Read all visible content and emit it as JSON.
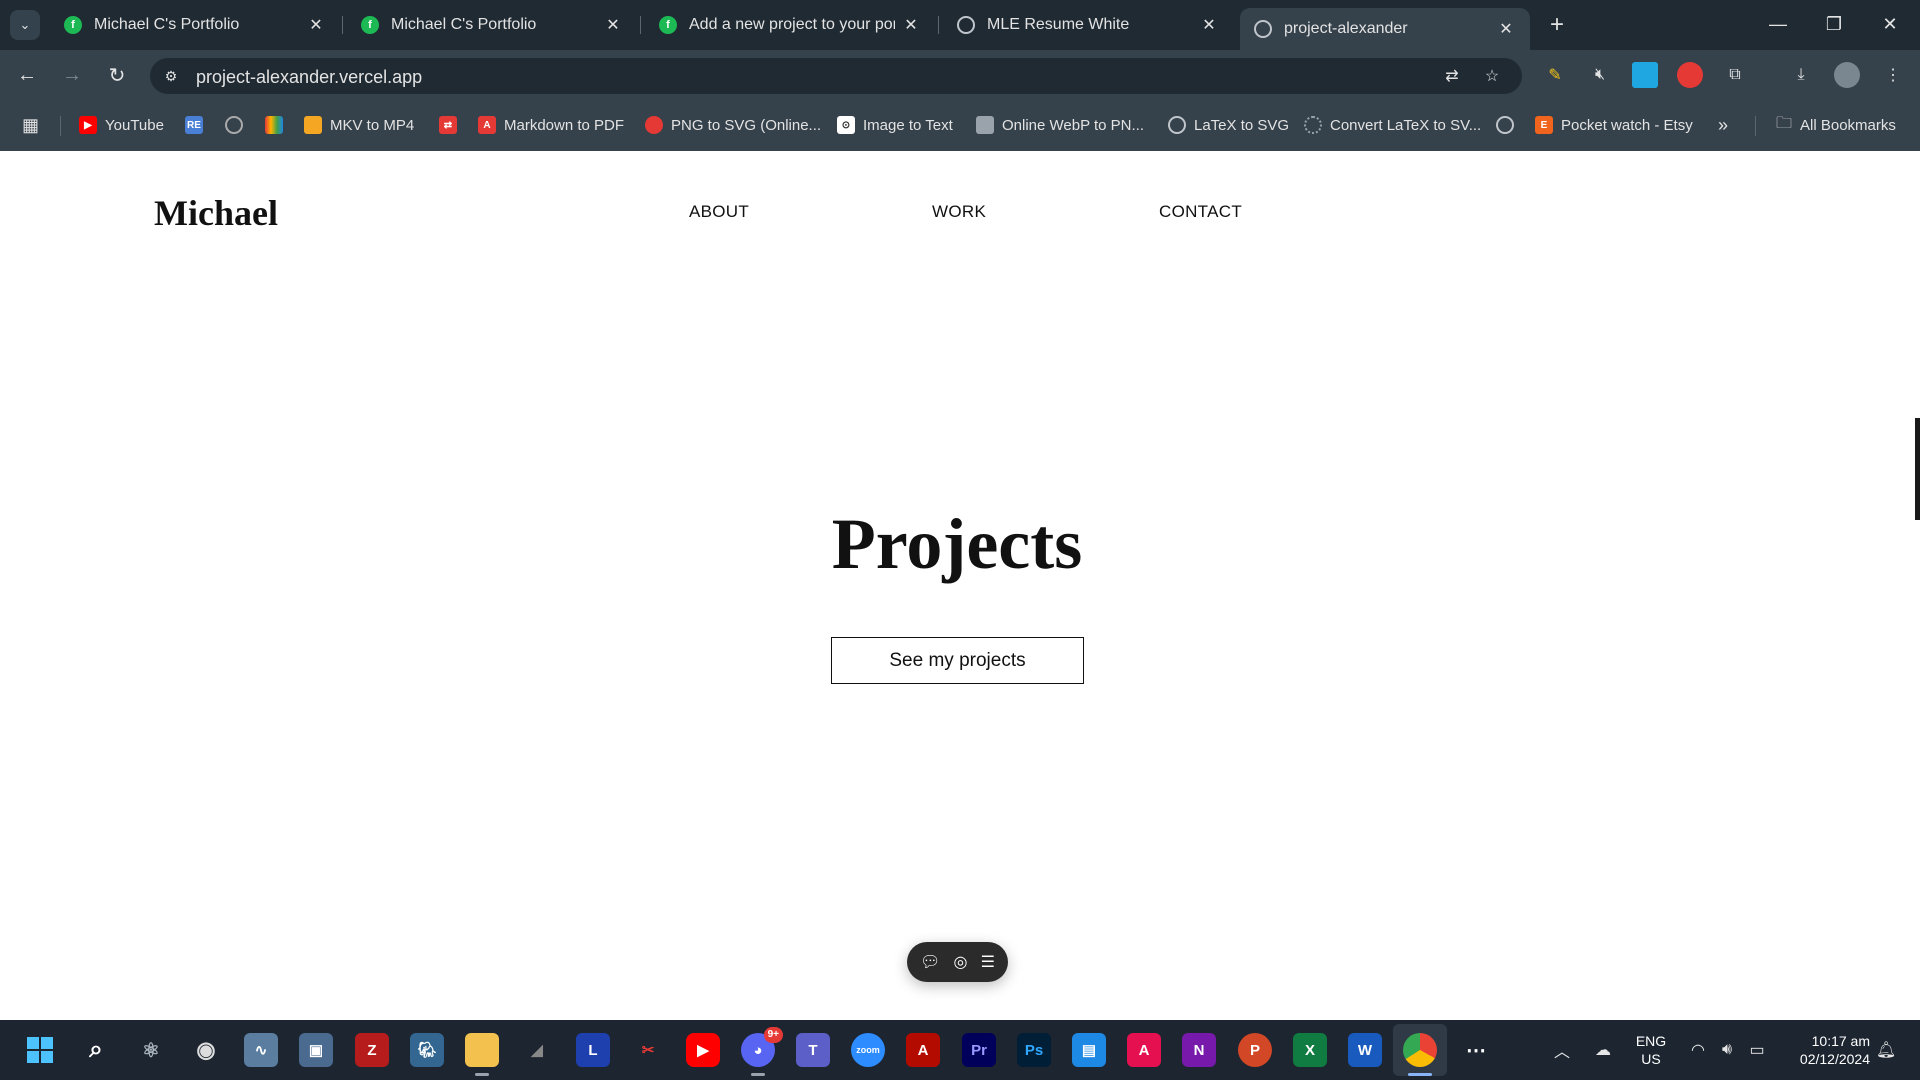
{
  "browser": {
    "tabs": [
      {
        "title": "Michael C's Portfolio",
        "favicon": "framer-green-icon",
        "active": false
      },
      {
        "title": "Michael C's Portfolio",
        "favicon": "framer-green-icon",
        "active": false
      },
      {
        "title": "Add a new project to your portf",
        "favicon": "framer-green-icon",
        "active": false
      },
      {
        "title": "MLE Resume White",
        "favicon": "globe-icon",
        "active": false
      },
      {
        "title": "project-alexander",
        "favicon": "globe-icon",
        "active": true
      }
    ],
    "url": "project-alexander.vercel.app",
    "bookmarks": [
      {
        "label": "YouTube",
        "icon": "youtube-icon",
        "color": "#ff0000"
      },
      {
        "label": "",
        "icon": "repo-icon",
        "color": "#4a7fd6"
      },
      {
        "label": "",
        "icon": "fingerprint-icon",
        "color": "#aaaaaa"
      },
      {
        "label": "",
        "icon": "color-grid-icon",
        "color": "#ffb300"
      },
      {
        "label": "MKV to MP4",
        "icon": "mkv-icon",
        "color": "#f5a623"
      },
      {
        "label": "",
        "icon": "convert-icon",
        "color": "#e53935"
      },
      {
        "label": "Markdown to PDF",
        "icon": "markdown-pdf-icon",
        "color": "#e53935"
      },
      {
        "label": "PNG to SVG (Online...",
        "icon": "png-svg-icon",
        "color": "#e53935"
      },
      {
        "label": "Image to Text",
        "icon": "image-text-icon",
        "color": "#ffffff"
      },
      {
        "label": "Online WebP to PN...",
        "icon": "webp-icon",
        "color": "#9aa3ab"
      },
      {
        "label": "LaTeX to SVG",
        "icon": "globe-icon",
        "color": "#bfc5ca"
      },
      {
        "label": "Convert LaTeX to SV...",
        "icon": "loading-icon",
        "color": "#9aa3ab"
      },
      {
        "label": "",
        "icon": "globe-icon",
        "color": "#bfc5ca"
      },
      {
        "label": "Pocket watch - Etsy",
        "icon": "etsy-icon",
        "color": "#f1641e"
      }
    ],
    "all_bookmarks_label": "All Bookmarks"
  },
  "site": {
    "logo": "Michael",
    "nav": [
      "ABOUT",
      "WORK",
      "CONTACT"
    ],
    "hero_title": "Projects",
    "cta_label": "See my projects"
  },
  "taskbar": {
    "notification_badge": "9+",
    "lang_line1": "ENG",
    "lang_line2": "US",
    "time": "10:17 am",
    "date": "02/12/2024"
  }
}
